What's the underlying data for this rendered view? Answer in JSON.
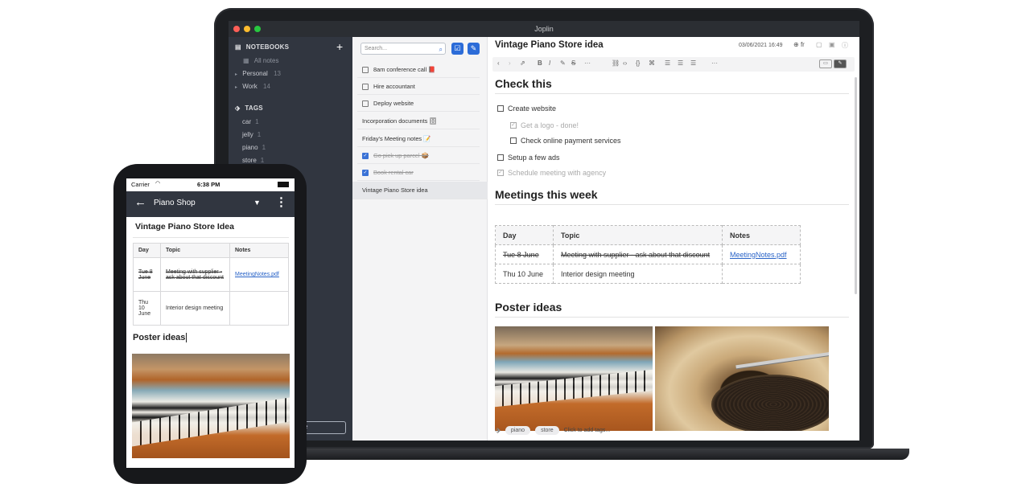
{
  "desktop": {
    "app_title": "Joplin",
    "window_dots": [
      "#ff5f57",
      "#febc2e",
      "#28c840"
    ],
    "sidebar": {
      "notebooks_label": "NOTEBOOKS",
      "all_notes": "All notes",
      "notebooks": [
        {
          "name": "Personal",
          "count": "13"
        },
        {
          "name": "Work",
          "count": "14"
        }
      ],
      "tags_label": "TAGS",
      "tags": [
        {
          "name": "car",
          "count": "1"
        },
        {
          "name": "jelly",
          "count": "1"
        },
        {
          "name": "piano",
          "count": "1"
        },
        {
          "name": "store",
          "count": "1"
        }
      ],
      "sync_button_fragment": "se"
    },
    "notelist": {
      "search_placeholder": "Search...",
      "notes": [
        {
          "title": "8am conference call 📕",
          "todo": true,
          "done": false
        },
        {
          "title": "Hire accountant",
          "todo": true,
          "done": false
        },
        {
          "title": "Deploy website",
          "todo": true,
          "done": false
        },
        {
          "title": "Incorporation documents 🗄",
          "todo": false,
          "done": false
        },
        {
          "title": "Friday's Meeting notes 📝",
          "todo": false,
          "done": false
        },
        {
          "title": "Go pick up parcel 📦",
          "todo": true,
          "done": true
        },
        {
          "title": "Book rental car",
          "todo": true,
          "done": true
        },
        {
          "title": "Vintage Piano Store idea",
          "todo": false,
          "done": false,
          "selected": true
        }
      ]
    },
    "editor": {
      "title": "Vintage Piano Store idea",
      "date": "03/06/2021 16:49",
      "lang": "fr",
      "section1": "Check this",
      "checklist": [
        {
          "text": "Create website",
          "done": false,
          "indent": false
        },
        {
          "text": "Get a logo - done!",
          "done": true,
          "indent": true
        },
        {
          "text": "Check online payment services",
          "done": false,
          "indent": true
        },
        {
          "text": "Setup a few ads",
          "done": false,
          "indent": false
        },
        {
          "text": "Schedule meeting with agency",
          "done": true,
          "indent": false
        }
      ],
      "section2": "Meetings this week",
      "table": {
        "headers": [
          "Day",
          "Topic",
          "Notes"
        ],
        "rows": [
          {
            "day": "Tue 8 June",
            "topic": "Meeting with supplier - ask about that discount",
            "notes": "MeetingNotes.pdf"
          },
          {
            "day": "Thu 10 June",
            "topic": "Interior design meeting",
            "notes": ""
          }
        ]
      },
      "section3": "Poster ideas",
      "tags": [
        "piano",
        "store"
      ],
      "add_tags": "Click to add tags..."
    }
  },
  "mobile": {
    "carrier": "Carrier",
    "time": "6:38 PM",
    "header_title": "Piano Shop",
    "note_title": "Vintage Piano Store Idea",
    "table": {
      "headers": [
        "Day",
        "Topic",
        "Notes"
      ],
      "rows": [
        {
          "day": "Tue 8 June",
          "topic": "Meeting with supplier - ask about that discount",
          "notes": "MeetingNotes.pdf"
        },
        {
          "day": "Thu 10 June",
          "topic": "Interior design meeting",
          "notes": ""
        }
      ]
    },
    "poster_heading": "Poster ideas"
  }
}
